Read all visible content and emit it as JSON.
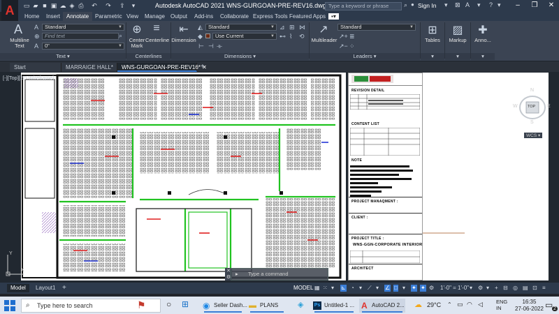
{
  "window": {
    "title": "Autodesk AutoCAD 2021    WNS-GURGOAN-PRE-REV16.dwg",
    "search_placeholder": "Type a keyword or phrase",
    "sign_in": "Sign In"
  },
  "ribbon_tabs": [
    "Home",
    "Insert",
    "Annotate",
    "Parametric",
    "View",
    "Manage",
    "Output",
    "Add-ins",
    "Collaborate",
    "Express Tools",
    "Featured Apps"
  ],
  "ribbon_active_tab": "Annotate",
  "ribbon": {
    "text_panel": {
      "title": "Text",
      "multiline_text": "Multiline\nText",
      "style_value": "Standard",
      "find_placeholder": "Find text",
      "height_value": "0\""
    },
    "centerlines_panel": {
      "title": "Centerlines",
      "center_mark": "Center\nMark",
      "centerline": "Centerline"
    },
    "dimensions_panel": {
      "title": "Dimensions",
      "dimension": "Dimension",
      "style_value": "Standard",
      "layer_value": "Use Current"
    },
    "leaders_panel": {
      "title": "Leaders",
      "multileader": "Multileader",
      "style_value": "Standard"
    },
    "tables": "Tables",
    "markup": "Markup",
    "annotation": "Anno..."
  },
  "file_tabs": [
    {
      "label": "Start"
    },
    {
      "label": "MARRAIGE HALL*"
    },
    {
      "label": "WNS-GURGOAN-PRE-REV16*"
    }
  ],
  "viewport_label": "[-][Top][2D Wireframe]",
  "title_block": {
    "revision_detail": "REVISION DETAIL",
    "content_list": "CONTENT LIST",
    "note": "NOTE",
    "project_management": "PROJECT MANAQMENT :",
    "client": "CLIENT :",
    "project_title": "PROJECT TITLE :",
    "project_name": "WNS-GGN-CORPORATE INTERIOR",
    "architect": "ARCHITECT"
  },
  "viewcube": {
    "north": "N",
    "south": "S",
    "east": "E",
    "west": "W",
    "top": "TOP",
    "wcs": "WCS"
  },
  "command_placeholder": "Type a command",
  "layout_tabs": [
    "Model",
    "Layout1"
  ],
  "status": {
    "model": "MODEL",
    "scale": "1'-0\" = 1'-0\""
  },
  "taskbar": {
    "search_placeholder": "Type here to search",
    "apps": [
      "Seller Dash...",
      "PLANS",
      "Untitled-1 ...",
      "AutoCAD 2..."
    ],
    "weather": "29°C",
    "language": "ENG\nIN",
    "time": "16:35",
    "date": "27-06-2022",
    "notification_count": "2"
  },
  "colors": {
    "accent": "#3a7dd6",
    "autocad_red": "#e0332d",
    "ribbon_bg": "#3b4453",
    "title_bg": "#2d3a4c"
  }
}
